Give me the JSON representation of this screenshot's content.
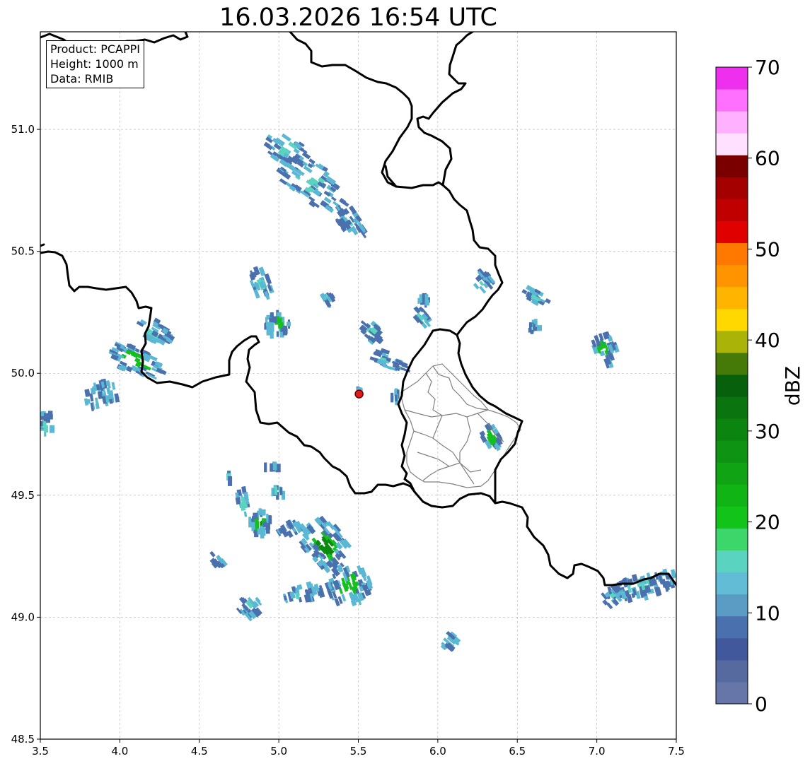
{
  "title": "16.03.2026 16:54 UTC",
  "info_box": {
    "product": "Product: PCAPPI",
    "height": "Height: 1000 m",
    "data": "Data: RMIB"
  },
  "map": {
    "lon_range": [
      3.5,
      7.5
    ],
    "lat_range": [
      48.5,
      51.4
    ],
    "x_ticks": [
      "3.5",
      "4.0",
      "4.5",
      "5.0",
      "5.5",
      "6.0",
      "6.5",
      "7.0",
      "7.5"
    ],
    "y_ticks": [
      "48.5",
      "49.0",
      "49.5",
      "50.0",
      "50.5",
      "51.0"
    ],
    "grid": true,
    "radar_site": {
      "lon": 5.505,
      "lat": 49.915,
      "color": "#e01b1b"
    }
  },
  "colorbar": {
    "label": "dBZ",
    "min": 0,
    "max": 70,
    "tick_labels": [
      "0",
      "10",
      "20",
      "30",
      "40",
      "50",
      "60",
      "70"
    ],
    "colors": [
      "#6676a8",
      "#566aa0",
      "#42589c",
      "#4a70ad",
      "#5a9cc4",
      "#62bcd6",
      "#5ad4c0",
      "#3cd66a",
      "#12c41a",
      "#10b414",
      "#10a414",
      "#0e9412",
      "#0c8410",
      "#0a740e",
      "#06600c",
      "#467a08",
      "#aab408",
      "#ffd800",
      "#ffb400",
      "#ff9400",
      "#ff7800",
      "#e00000",
      "#c00000",
      "#a40000",
      "#7a0000",
      "#ffe0ff",
      "#ffb0ff",
      "#ff70ff",
      "#ee30ee"
    ]
  },
  "echo_colors": {
    "light_blue": "#4a70ad",
    "cyan": "#5ab8d4",
    "teal": "#5ad4c0",
    "green": "#14c020",
    "dark_green": "#0c8a10"
  },
  "precip_cells": [
    {
      "lon": 5.1,
      "lat": 50.74,
      "intensity": "moderate"
    },
    {
      "lon": 4.9,
      "lat": 50.19,
      "intensity": "heavy"
    },
    {
      "lon": 4.1,
      "lat": 50.02,
      "intensity": "heavy"
    },
    {
      "lon": 4.86,
      "lat": 49.4,
      "intensity": "heavy"
    },
    {
      "lon": 5.28,
      "lat": 49.25,
      "intensity": "heavy"
    },
    {
      "lon": 7.0,
      "lat": 50.1,
      "intensity": "heavy"
    },
    {
      "lon": 7.25,
      "lat": 49.17,
      "intensity": "moderate"
    },
    {
      "lon": 6.3,
      "lat": 49.76,
      "intensity": "heavy"
    },
    {
      "lon": 6.05,
      "lat": 48.89,
      "intensity": "light"
    }
  ]
}
